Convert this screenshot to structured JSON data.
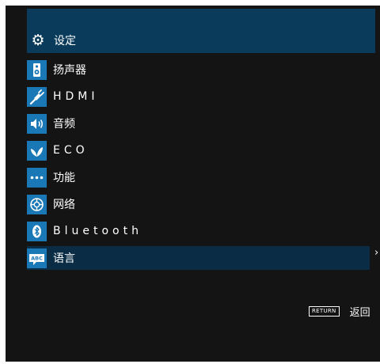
{
  "header": {
    "title": "设定",
    "icon": "gear-icon"
  },
  "menu": [
    {
      "label": "扬声器",
      "icon": "speaker-icon"
    },
    {
      "label": "HDMI",
      "icon": "hdmi-cable-icon"
    },
    {
      "label": "音频",
      "icon": "volume-icon"
    },
    {
      "label": "ECO",
      "icon": "leaf-icon"
    },
    {
      "label": "功能",
      "icon": "dots-icon"
    },
    {
      "label": "网络",
      "icon": "globe-icon"
    },
    {
      "label": "Bluetooth",
      "icon": "bluetooth-icon"
    },
    {
      "label": "语言",
      "icon": "abc-language-icon"
    }
  ],
  "selected_item": "语言",
  "footer": {
    "return_key": "RETURN",
    "return_label": "返回"
  },
  "colors": {
    "background": "#141414",
    "header": "#0a3b5a",
    "icon_bg": "#1b78b6",
    "selected_row": "#0a2c44",
    "text": "#ffffff"
  }
}
